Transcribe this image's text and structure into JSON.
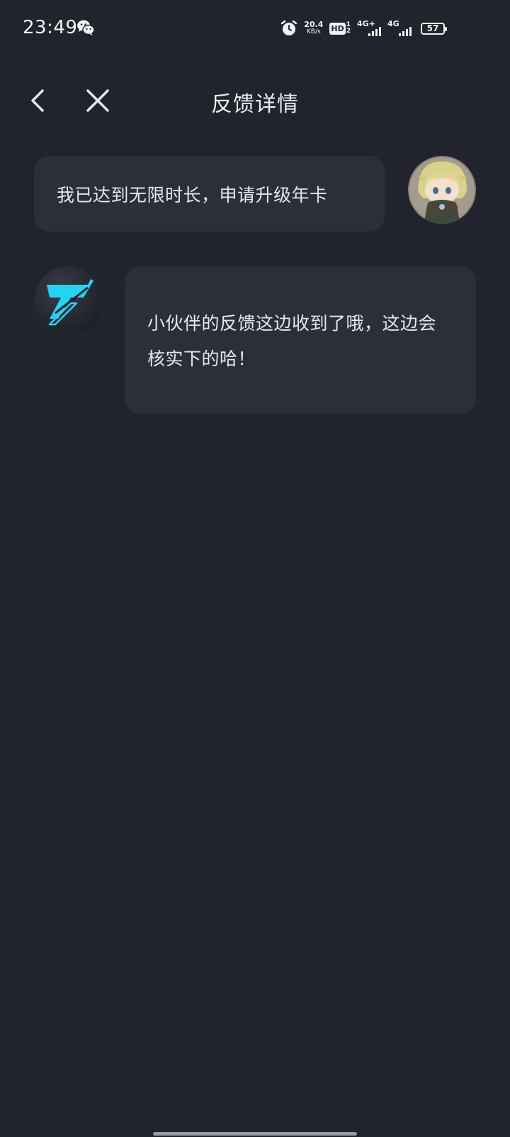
{
  "status_bar": {
    "time": "23:49",
    "net_speed_value": "20.4",
    "net_speed_unit": "KB/s",
    "hd_label": "HD",
    "hd_sim_1": "1",
    "hd_sim_2": "2",
    "sim1_network": "4G+",
    "sim2_network": "4G",
    "battery_level": "57",
    "icons": [
      "wechat-icon",
      "alarm-icon",
      "hd-voice-icon",
      "signal-icon",
      "battery-icon"
    ]
  },
  "nav": {
    "title": "反馈详情",
    "back_icon": "chevron-left-icon",
    "close_icon": "close-icon"
  },
  "conversation": {
    "messages": [
      {
        "sender": "user",
        "text": "我已达到无限时长，申请升级年卡"
      },
      {
        "sender": "support",
        "text": "小伙伴的反馈这边收到了哦，这边会核实下的哈！"
      }
    ]
  },
  "colors": {
    "background": "#22242d",
    "bubble": "#2c2e38",
    "text": "#e6e7ec",
    "brand_cyan": "#22d3f2"
  }
}
